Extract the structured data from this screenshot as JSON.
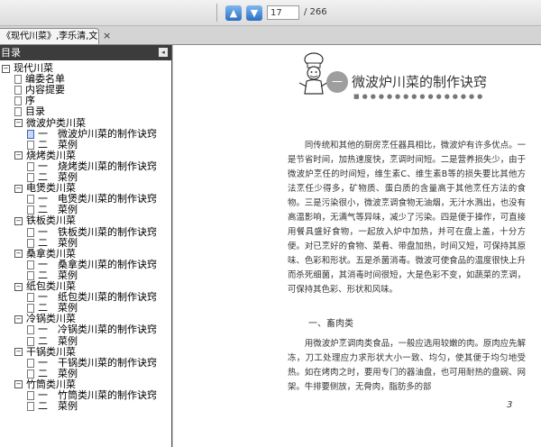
{
  "toolbar": {
    "page_current": "17",
    "page_total": "/ 266"
  },
  "tab": {
    "title": "《现代川菜》,李乐清,文字版",
    "close": "×"
  },
  "bookmarks": {
    "header": "目录",
    "collapse_icon": "◂",
    "items": [
      {
        "label": "现代川菜"
      },
      {
        "label": "编委名单"
      },
      {
        "label": "内容提要"
      },
      {
        "label": "序"
      },
      {
        "label": "目录"
      },
      {
        "label": "微波炉类川菜"
      },
      {
        "label": "一　微波炉川菜的制作诀窍"
      },
      {
        "label": "二　菜例"
      },
      {
        "label": "烧烤类川菜"
      },
      {
        "label": "一　烧烤类川菜的制作诀窍"
      },
      {
        "label": "二　菜例"
      },
      {
        "label": "电煲类川菜"
      },
      {
        "label": "一　电煲类川菜的制作诀窍"
      },
      {
        "label": "二　菜例"
      },
      {
        "label": "铁板类川菜"
      },
      {
        "label": "一　铁板类川菜的制作诀窍"
      },
      {
        "label": "二　菜例"
      },
      {
        "label": "桑拿类川菜"
      },
      {
        "label": "一　桑拿类川菜的制作诀窍"
      },
      {
        "label": "二　菜例"
      },
      {
        "label": "纸包类川菜"
      },
      {
        "label": "一　纸包类川菜的制作诀窍"
      },
      {
        "label": "二　菜例"
      },
      {
        "label": "冷锅类川菜"
      },
      {
        "label": "一　冷锅类川菜的制作诀窍"
      },
      {
        "label": "二　菜例"
      },
      {
        "label": "干锅类川菜"
      },
      {
        "label": "一　干锅类川菜的制作诀窍"
      },
      {
        "label": "二　菜例"
      },
      {
        "label": "竹筒类川菜"
      },
      {
        "label": "一　竹筒类川菜的制作诀窍"
      },
      {
        "label": "二　菜例"
      }
    ]
  },
  "document": {
    "chapter_number": "一",
    "chapter_title": "微波炉川菜的制作诀窍",
    "paragraph1": "　　同传统和其他的厨房烹任器具相比，微波炉有许多优点。一是节省时间，加热速度快，烹调时间短。二是营养损失少，由于微波炉烹任的时间短，维生素C、维生素B等的损失要比其他方法烹任少得多，矿物质、蛋白质的含量高于其他烹任方法的食物。三是污染很小，微波烹调食物无油烟，无汁水溅出，也没有高温影响，无满气等异味，减少了污染。四是便于操作，可直接用餐具盛好食物，一起放入炉中加热，并可在盘上盖，十分方便。对已烹好的食物、菜肴、带盘加热，时间又短，可保持其原味、色彩和形状。五是杀菌消毒。微波可使食品的温度很快上升而杀死细菌，其消毒时间很短，大是色彩不变，如蔬菜的烹调，可保持其色彩、形状和风味。",
    "section_heading": "一、畜肉类",
    "paragraph2": "　　用微波炉烹调肉类食品，一般应选用较嫩的肉。原肉应先解冻，刀工处理应力求形状大小一致、均匀，使其便于均匀地受热。如在烤肉之时，要用专门的器油盘，也可用耐热的盘碗、网架。牛排要侧放，无骨肉，脂肪多的部",
    "page_number": "3"
  }
}
